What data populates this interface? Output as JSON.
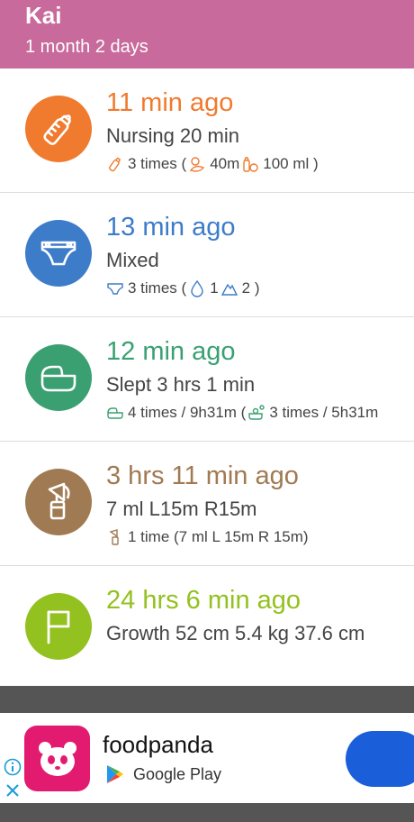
{
  "header": {
    "name": "Kai",
    "age": "1 month 2 days"
  },
  "colors": {
    "header": "#c86a9b",
    "feeding": "#f07a2e",
    "diaper": "#3d7cc9",
    "sleep": "#3aa072",
    "pump": "#a07a52",
    "growth": "#93c11f"
  },
  "rows": [
    {
      "icon": "bottle-icon",
      "ago": "11 min ago",
      "main": "Nursing 20 min",
      "sub": {
        "count": "3 times (",
        "duration": "40m",
        "volume": "100 ml )"
      }
    },
    {
      "icon": "diaper-icon",
      "ago": "13 min ago",
      "main": "Mixed",
      "sub": {
        "count": "3 times (",
        "wet": "1",
        "dirty": "2 )"
      }
    },
    {
      "icon": "crib-icon",
      "ago": "12 min ago",
      "main": "Slept 3 hrs 1 min",
      "sub": {
        "count": "4 times / 9h31m (",
        "nap": "3 times / 5h31m"
      }
    },
    {
      "icon": "breast-pump-icon",
      "ago": "3 hrs 11 min ago",
      "main": "7 ml L15m R15m",
      "sub": {
        "count": "1 time (7 ml  L 15m R 15m)"
      }
    },
    {
      "icon": "flag-icon",
      "ago": "24 hrs 6 min ago",
      "main": "Growth 52 cm 5.4 kg 37.6 cm"
    }
  ],
  "ad": {
    "title": "foodpanda",
    "store": "Google Play"
  }
}
